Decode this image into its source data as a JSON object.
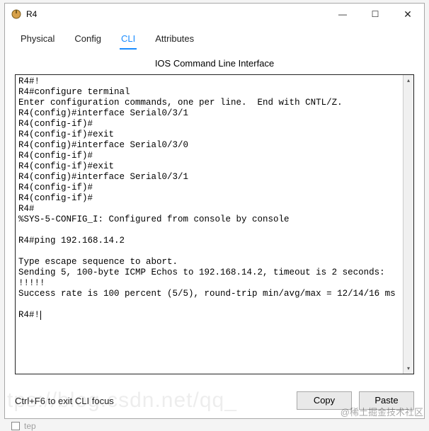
{
  "window": {
    "title": "R4",
    "controls": {
      "min": "—",
      "max": "☐",
      "close": "✕"
    }
  },
  "tabs": [
    {
      "label": "Physical",
      "active": false
    },
    {
      "label": "Config",
      "active": false
    },
    {
      "label": "CLI",
      "active": true
    },
    {
      "label": "Attributes",
      "active": false
    }
  ],
  "panel": {
    "title": "IOS Command Line Interface"
  },
  "terminal_lines": "R4#!\nR4#configure terminal\nEnter configuration commands, one per line.  End with CNTL/Z.\nR4(config)#interface Serial0/3/1\nR4(config-if)#\nR4(config-if)#exit\nR4(config)#interface Serial0/3/0\nR4(config-if)#\nR4(config-if)#exit\nR4(config)#interface Serial0/3/1\nR4(config-if)#\nR4(config-if)#\nR4#\n%SYS-5-CONFIG_I: Configured from console by console\n\nR4#ping 192.168.14.2\n\nType escape sequence to abort.\nSending 5, 100-byte ICMP Echos to 192.168.14.2, timeout is 2 seconds:\n!!!!!\nSuccess rate is 100 percent (5/5), round-trip min/avg/max = 12/14/16 ms\n\nR4#!",
  "footer": {
    "hint": "Ctrl+F6 to exit CLI focus",
    "copy_label": "Copy",
    "paste_label": "Paste"
  },
  "watermark": {
    "ghost": "tps://blog.csdn.net/qq_",
    "cn": "@稀土掘金技术社区",
    "checkbox_label": "tep"
  }
}
